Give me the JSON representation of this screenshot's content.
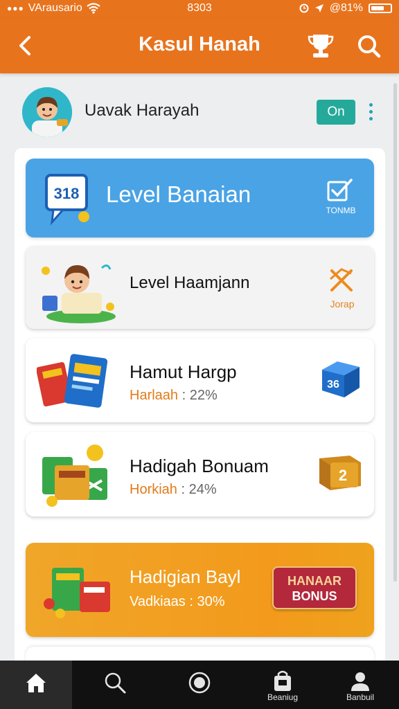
{
  "status_bar": {
    "carrier": "VArausario",
    "time": "8303",
    "battery": "@81%"
  },
  "app_bar": {
    "title": "Kasul Hanah"
  },
  "profile": {
    "name": "Uavak Harayah",
    "toggle_label": "On"
  },
  "cards": {
    "level_banner": {
      "label": "Level Banaian",
      "action_caption": "TONMB",
      "icon_text": "318"
    },
    "level_item": {
      "label": "Level Haamjann",
      "action_caption": "Jorap"
    },
    "item_hamut": {
      "label": "Hamut Hargp",
      "sub_key": "Harlaah",
      "sub_value": ": 22%",
      "badge": "36"
    },
    "item_hadigah": {
      "label": "Hadigah Bonuam",
      "sub_key": "Horkiah",
      "sub_value": ": 24%",
      "badge": "2"
    },
    "promo": {
      "label": "Hadigian Bayl",
      "sub": "Vadkiaas : 30%",
      "button_line1": "HANAAR",
      "button_line2": "BONUS"
    }
  },
  "bottom_nav": {
    "items": [
      {
        "icon": "home-icon",
        "caption": ""
      },
      {
        "icon": "search-icon",
        "caption": ""
      },
      {
        "icon": "record-icon",
        "caption": ""
      },
      {
        "icon": "bag-icon",
        "caption": "Beaniug"
      },
      {
        "icon": "person-icon",
        "caption": "Banbuil"
      }
    ]
  },
  "colors": {
    "brand_orange": "#e8731d",
    "banner_blue": "#4aa3e5",
    "accent_teal": "#25a99a",
    "promo_orange": "#f39a1c",
    "bonus_red": "#b3283b"
  }
}
